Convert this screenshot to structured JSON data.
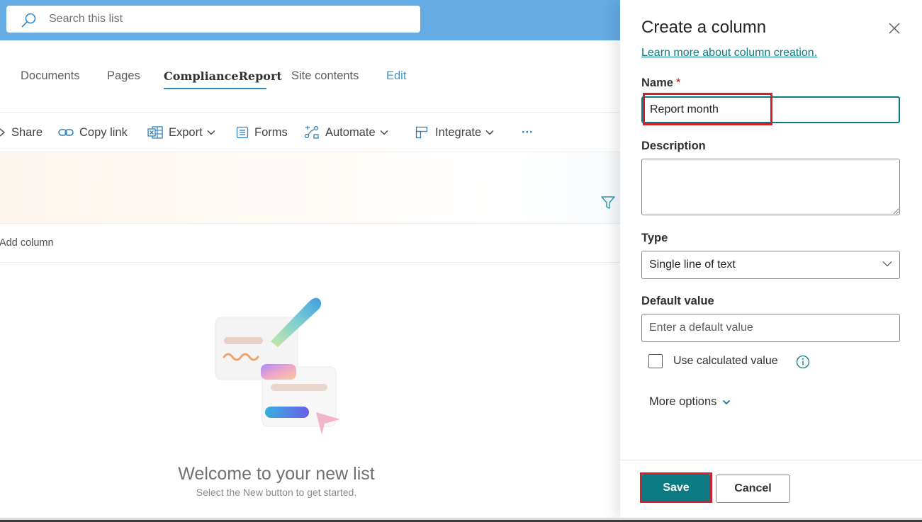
{
  "search": {
    "placeholder": "Search this list"
  },
  "nav": {
    "items": [
      {
        "label": "Documents"
      },
      {
        "label": "Pages"
      },
      {
        "label": "ComplianceReport"
      },
      {
        "label": "Site contents"
      },
      {
        "label": "Edit"
      }
    ],
    "active": "ComplianceReport"
  },
  "commands": {
    "share": "Share",
    "copy_link": "Copy link",
    "export": "Export",
    "forms": "Forms",
    "automate": "Automate",
    "integrate": "Integrate",
    "more": "···"
  },
  "list": {
    "add_column": "Add column",
    "empty_title": "Welcome to your new list",
    "empty_subtitle": "Select the New button to get started."
  },
  "panel": {
    "title": "Create a column",
    "learn_more": "Learn more about column creation.",
    "name_label": "Name",
    "required_mark": "*",
    "name_value": "Report month",
    "description_label": "Description",
    "description_value": "",
    "type_label": "Type",
    "type_value": "Single line of text",
    "default_label": "Default value",
    "default_placeholder": "Enter a default value",
    "calculated_label": "Use calculated value",
    "more_options": "More options",
    "save": "Save",
    "cancel": "Cancel"
  },
  "colors": {
    "header_blue": "#64ace3",
    "accent_teal": "#0b7a83",
    "highlight_red": "#d3212c",
    "nav_link": "#3d96c9"
  }
}
